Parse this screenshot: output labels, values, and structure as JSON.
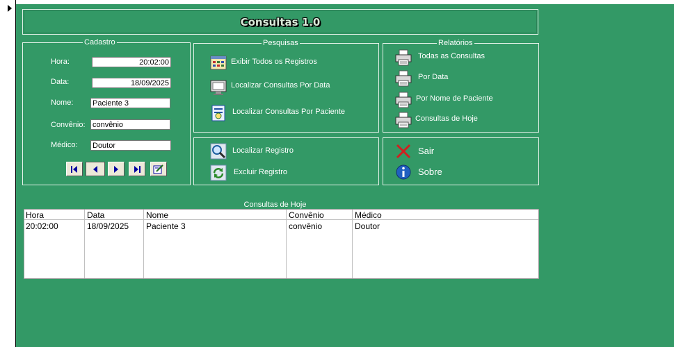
{
  "window": {
    "title": "Consultas 1.0"
  },
  "cadastro": {
    "legend": "Cadastro",
    "fields": [
      {
        "label": "Hora:",
        "value": "20:02:00"
      },
      {
        "label": "Data:",
        "value": "18/09/2025"
      },
      {
        "label": "Nome:",
        "value": "Paciente 3"
      },
      {
        "label": "Convênio:",
        "value": "convênio"
      },
      {
        "label": "Médico:",
        "value": "Doutor"
      }
    ]
  },
  "pesquisas": {
    "legend": "Pesquisas",
    "items": [
      {
        "label": "Exibir Todos os Registros",
        "icon": "table-grid-icon"
      },
      {
        "label": "Localizar Consultas Por Data",
        "icon": "monitor-icon"
      },
      {
        "label": "Localizar Consultas Por Paciente",
        "icon": "form-search-icon"
      }
    ]
  },
  "registro": {
    "items": [
      {
        "label": "Localizar Registro",
        "icon": "magnifier-icon"
      },
      {
        "label": "Excluir Registro",
        "icon": "refresh-doc-icon"
      }
    ]
  },
  "relatorios": {
    "legend": "Relatórios",
    "items": [
      {
        "label": "Todas as Consultas",
        "icon": "printer-icon"
      },
      {
        "label": "Por Data",
        "icon": "printer-icon"
      },
      {
        "label": "Por Nome de Paciente",
        "icon": "printer-icon"
      },
      {
        "label": "Consultas de Hoje",
        "icon": "printer-icon"
      }
    ]
  },
  "actions": {
    "sair": "Sair",
    "sobre": "Sobre"
  },
  "today": {
    "caption": "Consultas de Hoje",
    "columns": [
      "Hora",
      "Data",
      "Nome",
      "Convênio",
      "Médico"
    ],
    "rows": [
      [
        "20:02:00",
        "18/09/2025",
        "Paciente 3",
        "convênio",
        "Doutor"
      ]
    ]
  },
  "colors": {
    "form_bg": "#339966",
    "nav_icon": "#0000a0"
  }
}
